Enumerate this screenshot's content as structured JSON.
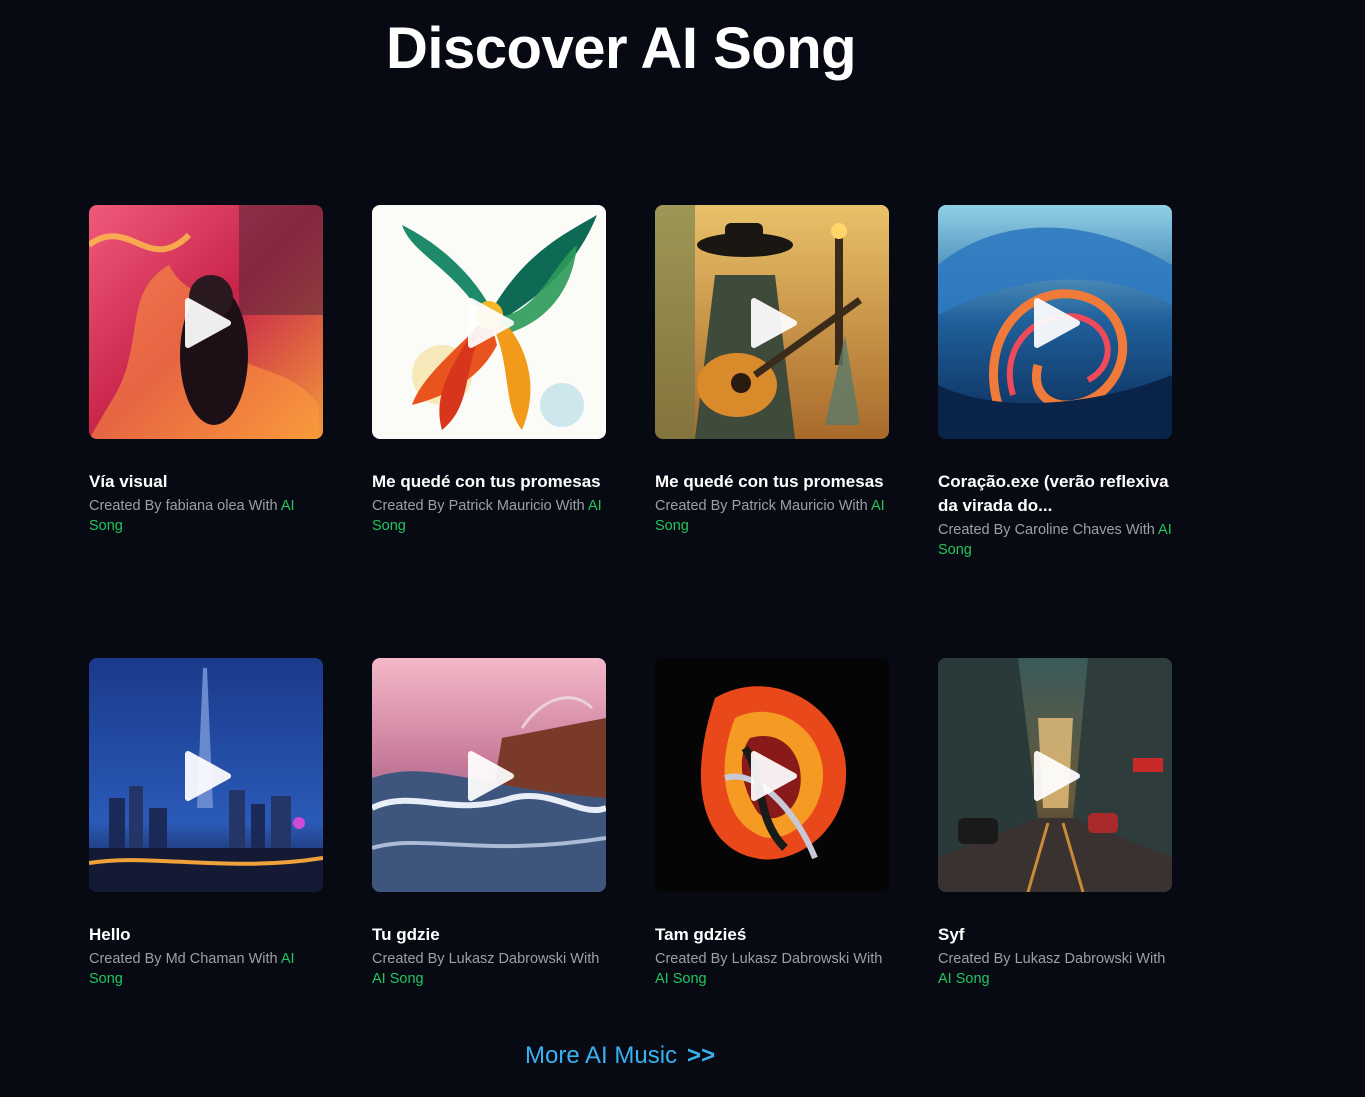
{
  "page_title": "Discover AI Song",
  "created_by_prefix": "Created By",
  "with_word": "With",
  "brand_name": "AI Song",
  "brand_color": "#22c55e",
  "link_color": "#38b3f0",
  "icons": {
    "play": "play-icon"
  },
  "songs": [
    {
      "title": "Vía visual",
      "creator": "fabiana olea",
      "art": "fiery-hooded-figure"
    },
    {
      "title": "Me quedé con tus promesas",
      "creator": "Patrick Mauricio",
      "art": "phoenix-splash"
    },
    {
      "title": "Me quedé con tus promesas",
      "creator": "Patrick Mauricio",
      "art": "guitar-woman-street"
    },
    {
      "title": "Coração.exe (verão reflexiva da virada do...",
      "creator": "Caroline Chaves",
      "art": "ocean-wave"
    },
    {
      "title": "Hello",
      "creator": "Md Chaman",
      "art": "night-city-skyline"
    },
    {
      "title": "Tu gdzie",
      "creator": "Lukasz Dabrowski",
      "art": "sunset-sea-cliff"
    },
    {
      "title": "Tam gdzieś",
      "creator": "Lukasz Dabrowski",
      "art": "fire-dragon"
    },
    {
      "title": "Syf",
      "creator": "Lukasz Dabrowski",
      "art": "rainy-city-street"
    }
  ],
  "more_link": {
    "label": "More AI Music",
    "arrows": ">>"
  }
}
